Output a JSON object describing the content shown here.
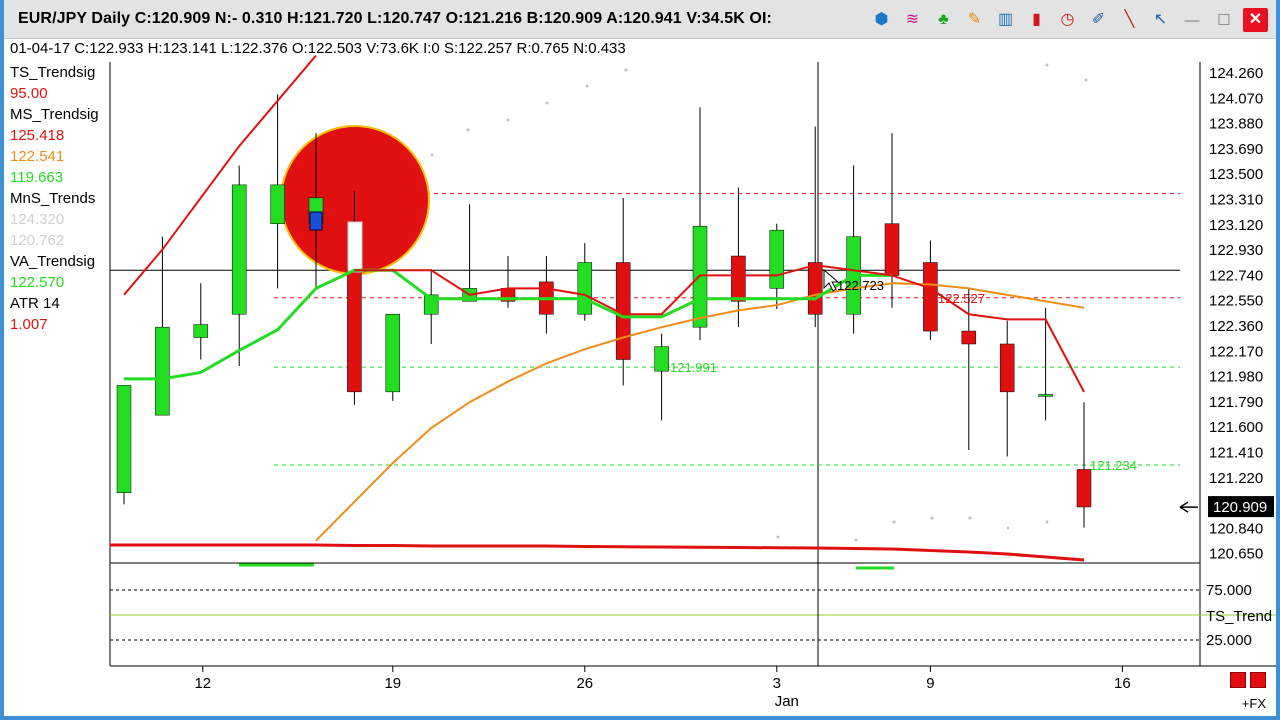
{
  "window": {
    "title": "EUR/JPY Daily  C:120.909  N:- 0.310  H:121.720  L:120.747  O:121.216  B:120.909  A:120.941  V:34.5K  OI:",
    "toolbar_icons": [
      "dollar-tool-icon",
      "trendline-waves-icon",
      "tree-icon",
      "pencil-icon",
      "bar-chart-icon",
      "candle-icon",
      "clock-icon",
      "edit-icon",
      "ruler-icon",
      "cursor-icon"
    ],
    "minimize": "—",
    "maximize": "☐",
    "close": "✕"
  },
  "info_line": "01-04-17  C:122.933  H:123.141  L:122.376  O:122.503  V:73.6K  I:0  S:122.257  R:0.765  N:0.433",
  "indicators": [
    {
      "name": "TS_Trendsig",
      "values": [
        {
          "v": "95.00",
          "color": "#e01010"
        }
      ]
    },
    {
      "name": "MS_Trendsig",
      "values": [
        {
          "v": "125.418",
          "color": "#e01010"
        },
        {
          "v": "122.541",
          "color": "#f08c1a"
        },
        {
          "v": "119.663",
          "color": "#22dd22"
        }
      ]
    },
    {
      "name": "MnS_Trends",
      "values": [
        {
          "v": "124.320",
          "color": "#cfcfcf"
        },
        {
          "v": "120.762",
          "color": "#cfcfcf"
        }
      ]
    },
    {
      "name": "VA_Trendsig",
      "values": [
        {
          "v": "122.570",
          "color": "#22dd22"
        }
      ]
    },
    {
      "name": "ATR  14",
      "values": [
        {
          "v": "1.007",
          "color": "#e01010"
        }
      ]
    }
  ],
  "bottom": {
    "fx_label": "+FX"
  },
  "chart_data": {
    "type": "candlestick",
    "ylim": [
      120.5,
      124.35
    ],
    "y_ticks": [
      "124.260",
      "124.070",
      "123.880",
      "123.690",
      "123.500",
      "123.310",
      "123.120",
      "122.930",
      "122.740",
      "122.550",
      "122.360",
      "122.170",
      "121.980",
      "121.790",
      "121.600",
      "121.410",
      "121.220",
      "121.030",
      "120.840",
      "120.650"
    ],
    "x_ticks": [
      {
        "label": "12",
        "day": 2
      },
      {
        "label": "19",
        "day": 7
      },
      {
        "label": "26",
        "day": 12
      },
      {
        "label": "3",
        "day": 17,
        "sub": "Jan"
      },
      {
        "label": "9",
        "day": 21
      },
      {
        "label": "16",
        "day": 26
      }
    ],
    "candles": [
      {
        "o": 121.02,
        "h": 121.76,
        "l": 120.93,
        "c": 121.85
      },
      {
        "o": 121.62,
        "h": 123.0,
        "l": 121.62,
        "c": 122.3
      },
      {
        "o": 122.22,
        "h": 122.64,
        "l": 122.05,
        "c": 122.32
      },
      {
        "o": 122.4,
        "h": 123.55,
        "l": 122.0,
        "c": 123.4
      },
      {
        "o": 123.1,
        "h": 124.1,
        "l": 122.6,
        "c": 123.4
      },
      {
        "o": 123.1,
        "h": 123.8,
        "l": 122.6,
        "c": 123.3
      },
      {
        "o": 122.75,
        "h": 123.35,
        "l": 121.7,
        "c": 121.8
      },
      {
        "o": 121.8,
        "h": 122.38,
        "l": 121.73,
        "c": 122.4
      },
      {
        "o": 122.4,
        "h": 122.75,
        "l": 122.17,
        "c": 122.55
      },
      {
        "o": 122.5,
        "h": 123.25,
        "l": 122.5,
        "c": 122.6
      },
      {
        "o": 122.6,
        "h": 122.85,
        "l": 122.45,
        "c": 122.5
      },
      {
        "o": 122.65,
        "h": 122.85,
        "l": 122.25,
        "c": 122.4
      },
      {
        "o": 122.4,
        "h": 122.95,
        "l": 122.35,
        "c": 122.8
      },
      {
        "o": 122.8,
        "h": 123.3,
        "l": 121.85,
        "c": 122.05
      },
      {
        "o": 121.96,
        "h": 122.25,
        "l": 121.58,
        "c": 122.15
      },
      {
        "o": 122.3,
        "h": 124.0,
        "l": 122.2,
        "c": 123.08
      },
      {
        "o": 122.85,
        "h": 123.38,
        "l": 122.3,
        "c": 122.5
      },
      {
        "o": 122.6,
        "h": 123.1,
        "l": 122.44,
        "c": 123.05
      },
      {
        "o": 122.8,
        "h": 123.85,
        "l": 122.3,
        "c": 122.4
      },
      {
        "o": 122.4,
        "h": 123.55,
        "l": 122.25,
        "c": 123.0
      },
      {
        "o": 123.1,
        "h": 123.8,
        "l": 122.45,
        "c": 122.7
      },
      {
        "o": 122.8,
        "h": 122.97,
        "l": 122.2,
        "c": 122.27
      },
      {
        "o": 122.27,
        "h": 122.6,
        "l": 121.35,
        "c": 122.17
      },
      {
        "o": 122.17,
        "h": 122.35,
        "l": 121.3,
        "c": 121.8
      },
      {
        "o": 121.78,
        "h": 122.45,
        "l": 121.58,
        "c": 121.78
      },
      {
        "o": 121.2,
        "h": 121.72,
        "l": 120.75,
        "c": 120.91
      }
    ],
    "series": [
      {
        "name": "MS_Trendsig upper",
        "color": "#e01010",
        "values": [
          122.55,
          122.9,
          123.3,
          123.7,
          124.05,
          124.4,
          null,
          null,
          null,
          null,
          null,
          null,
          null,
          null,
          null,
          null,
          null,
          null,
          null,
          null,
          null,
          null,
          null,
          null,
          null,
          null
        ]
      },
      {
        "name": "MS_Trendsig mid",
        "color": "#f08c1a",
        "values": [
          null,
          null,
          null,
          null,
          null,
          120.65,
          120.95,
          121.25,
          121.52,
          121.72,
          121.88,
          122.02,
          122.13,
          122.22,
          122.3,
          122.37,
          122.43,
          122.47,
          122.55,
          122.6,
          122.64,
          122.63,
          122.6,
          122.55,
          122.5,
          122.45
        ]
      },
      {
        "name": "VA_Trendsig",
        "color": "#22dd22",
        "values": [
          121.9,
          121.9,
          121.95,
          122.12,
          122.28,
          122.6,
          122.74,
          122.74,
          122.52,
          122.52,
          122.52,
          122.52,
          122.52,
          122.38,
          122.38,
          122.52,
          122.52,
          122.52,
          122.52,
          122.7,
          122.7,
          null,
          null,
          null,
          null,
          null
        ]
      },
      {
        "name": "TS red line",
        "color": "#e01010",
        "values": [
          null,
          null,
          null,
          null,
          null,
          null,
          122.74,
          122.74,
          122.74,
          122.55,
          122.6,
          122.6,
          122.55,
          122.4,
          122.4,
          122.7,
          122.7,
          122.7,
          122.78,
          122.74,
          122.7,
          122.6,
          122.4,
          122.36,
          122.36,
          121.8
        ]
      }
    ],
    "levels": [
      {
        "value": 123.332,
        "label": "123.332",
        "color": "#e01010"
      },
      {
        "value": 122.527,
        "label": "122.527",
        "color": "#e01010"
      },
      {
        "value": 121.991,
        "label": "121.991",
        "color": "#22dd22"
      },
      {
        "value": 121.234,
        "label": "121.234",
        "color": "#22dd22"
      }
    ],
    "cursor_label": "122.723",
    "current_price": "120.909",
    "lower_panel": {
      "name": "TS_Trend",
      "ticks": [
        "75.000",
        "25.000"
      ],
      "line_values": [
        95,
        95,
        95,
        95,
        95,
        95,
        94.5,
        94.5,
        94,
        94,
        94,
        94,
        93.5,
        93.2,
        93,
        92.8,
        92.5,
        92.2,
        92,
        91.5,
        91,
        89.5,
        88,
        86,
        83,
        80
      ]
    }
  }
}
